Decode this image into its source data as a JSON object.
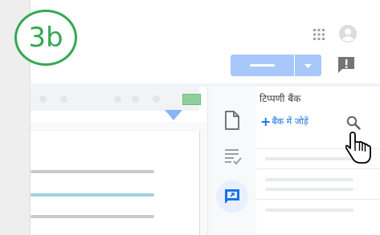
{
  "step_badge": "3b",
  "header": {
    "apps_icon": "grid-icon",
    "account_icon": "account-icon",
    "share_button_color": "#a8c7fa",
    "feedback_icon": "feedback-icon"
  },
  "side_rail": {
    "icons": [
      "document-icon",
      "checklist-icon",
      "comment-bank-icon"
    ],
    "active": "comment-bank-icon"
  },
  "comment_bank": {
    "title": "टिप्पणी बैंक",
    "add_label": "बैंक में जोड़ें",
    "search_icon": "search-icon"
  },
  "colors": {
    "badge": "#34a853",
    "link": "#1a73e8",
    "accent": "#8ab4f8",
    "ruler_marker": "#8fcf9e"
  }
}
